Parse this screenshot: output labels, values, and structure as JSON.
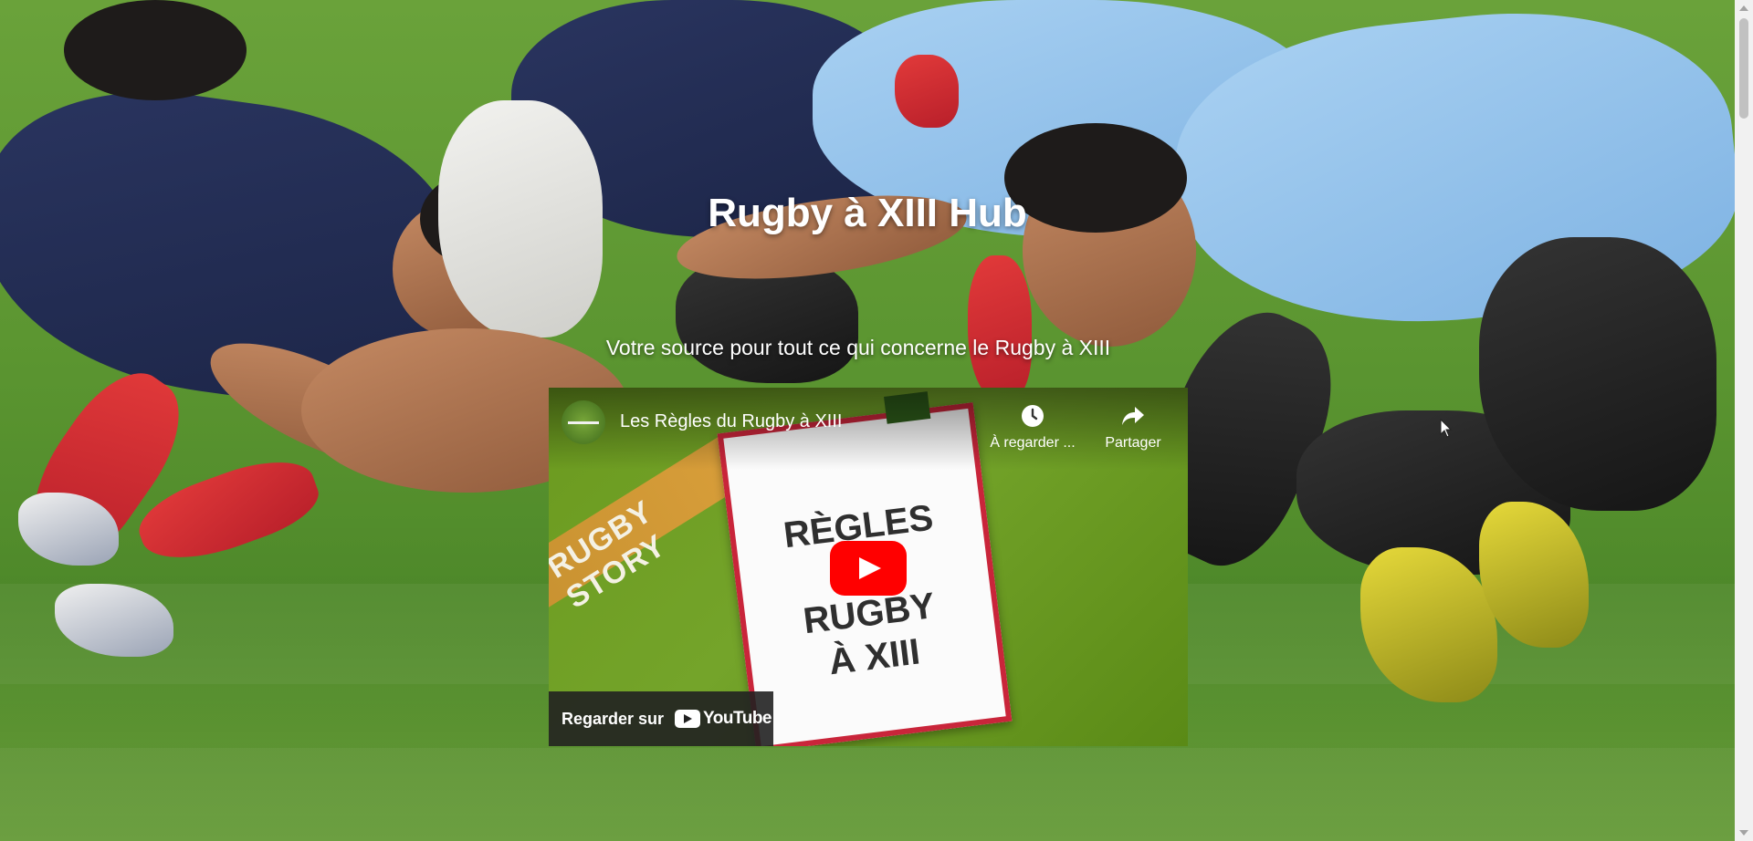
{
  "hero": {
    "title": "Rugby à XIII Hub",
    "subtitle": "Votre source pour tout ce qui concerne le Rugby à XIII"
  },
  "video": {
    "title": "Les Règles du Rugby à XIII",
    "channel_icon": "rugby-story-channel-avatar",
    "watch_later_label": "À regarder ...",
    "share_label": "Partager",
    "watch_on_label": "Regarder sur",
    "youtube_word": "YouTube",
    "thumbnail_banner": "RUGBY STORY",
    "thumbnail_poster_text": "RÈGLES DU RUGBY À XIII",
    "colors": {
      "play_button": "#ff0000",
      "poster_border": "#c9253a"
    }
  },
  "icons": [
    "clock-icon",
    "share-arrow-icon",
    "play-icon",
    "youtube-logo-icon"
  ]
}
